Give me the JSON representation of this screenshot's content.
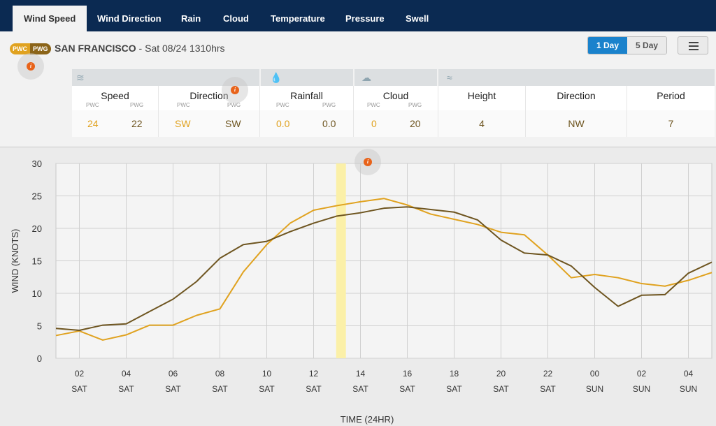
{
  "nav": {
    "tabs": [
      "Wind Speed",
      "Wind Direction",
      "Rain",
      "Cloud",
      "Temperature",
      "Pressure",
      "Swell"
    ],
    "active": "Wind Speed"
  },
  "header": {
    "badge_pwc": "PWC",
    "badge_pwg": "PWG",
    "location": "SAN FRANCISCO",
    "datetime": " - Sat 08/24 1310hrs"
  },
  "range": {
    "one_day": "1 Day",
    "five_day": "5 Day",
    "selected": "1 Day"
  },
  "info_glyph": "i",
  "table": {
    "icons": {
      "wind": "wind-icon",
      "rain": "raindrop-icon",
      "cloud": "cloud-icon",
      "swell": "wave-icon"
    },
    "sub_pwc": "PWC",
    "sub_pwg": "PWG",
    "speed": {
      "label": "Speed",
      "pwc": "24",
      "pwg": "22"
    },
    "direction": {
      "label": "Direction",
      "pwc": "SW",
      "pwg": "SW"
    },
    "rainfall": {
      "label": "Rainfall",
      "pwc": "0.0",
      "pwg": "0.0"
    },
    "cloud": {
      "label": "Cloud",
      "pwc": "0",
      "pwg": "20"
    },
    "height": {
      "label": "Height",
      "value": "4"
    },
    "swell_direction": {
      "label": "Direction",
      "value": "NW"
    },
    "period": {
      "label": "Period",
      "value": "7"
    }
  },
  "colors": {
    "pwc": "#e0a21f",
    "pwg": "#6e5520",
    "accent": "#1a82cc",
    "nav": "#0b2a52",
    "now_band": "#fbf0a8"
  },
  "chart_data": {
    "type": "line",
    "title": "",
    "xlabel": "TIME (24HR)",
    "ylabel": "WIND (KNOTS)",
    "ylim": [
      0,
      30
    ],
    "yticks": [
      0,
      5,
      10,
      15,
      20,
      25,
      30
    ],
    "grid": true,
    "x_hours": [
      1,
      2,
      3,
      4,
      5,
      6,
      7,
      8,
      9,
      10,
      11,
      12,
      13,
      14,
      15,
      16,
      17,
      18,
      19,
      20,
      21,
      22,
      23,
      24,
      25,
      26,
      27,
      28,
      29
    ],
    "xlim_hours": [
      1,
      29
    ],
    "xticks": [
      {
        "hour": 2,
        "label": "02",
        "day": "SAT"
      },
      {
        "hour": 4,
        "label": "04",
        "day": "SAT"
      },
      {
        "hour": 6,
        "label": "06",
        "day": "SAT"
      },
      {
        "hour": 8,
        "label": "08",
        "day": "SAT"
      },
      {
        "hour": 10,
        "label": "10",
        "day": "SAT"
      },
      {
        "hour": 12,
        "label": "12",
        "day": "SAT"
      },
      {
        "hour": 14,
        "label": "14",
        "day": "SAT"
      },
      {
        "hour": 16,
        "label": "16",
        "day": "SAT"
      },
      {
        "hour": 18,
        "label": "18",
        "day": "SAT"
      },
      {
        "hour": 20,
        "label": "20",
        "day": "SAT"
      },
      {
        "hour": 22,
        "label": "22",
        "day": "SAT"
      },
      {
        "hour": 24,
        "label": "00",
        "day": "SUN"
      },
      {
        "hour": 26,
        "label": "02",
        "day": "SUN"
      },
      {
        "hour": 28,
        "label": "04",
        "day": "SUN"
      }
    ],
    "now_marker_hour": 13.17,
    "series": [
      {
        "name": "PWC",
        "color": "#e0a21f",
        "values": [
          3.5,
          4.2,
          2.8,
          3.6,
          5.1,
          5.1,
          6.6,
          7.6,
          13.3,
          17.5,
          20.8,
          22.8,
          23.5,
          24.1,
          24.6,
          23.6,
          22.2,
          21.4,
          20.6,
          19.4,
          19.0,
          15.9,
          12.4,
          12.9,
          12.4,
          11.5,
          11.1,
          12.0,
          13.2
        ]
      },
      {
        "name": "PWG",
        "color": "#6e5520",
        "values": [
          4.6,
          4.3,
          5.1,
          5.3,
          7.2,
          9.1,
          11.8,
          15.4,
          17.5,
          18.0,
          19.5,
          20.8,
          21.9,
          22.4,
          23.1,
          23.3,
          22.9,
          22.5,
          21.3,
          18.2,
          16.2,
          15.9,
          14.2,
          10.9,
          8.0,
          9.7,
          9.8,
          13.1,
          14.8
        ]
      }
    ]
  }
}
